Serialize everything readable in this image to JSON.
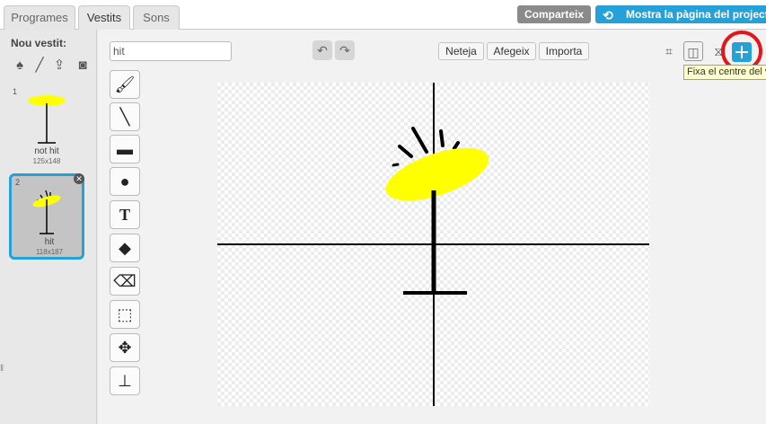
{
  "tabs": [
    {
      "label": "Programes"
    },
    {
      "label": "Vestits"
    },
    {
      "label": "Sons"
    }
  ],
  "header": {
    "share_label": "Comparteix",
    "project_page_label": "Mostra la pàgina del projecte"
  },
  "costume_panel": {
    "new_label": "Nou vestit:",
    "new_icons": [
      "sprite-library-icon",
      "paint-brush-icon",
      "upload-icon",
      "camera-icon"
    ],
    "costumes": [
      {
        "number": "1",
        "name": "not hit",
        "size": "125x148",
        "selected": false
      },
      {
        "number": "2",
        "name": "hit",
        "size": "118x187",
        "selected": true
      }
    ]
  },
  "editor": {
    "costume_name_value": "hit",
    "clear_label": "Neteja",
    "add_label": "Afegeix",
    "import_label": "Importa",
    "tooltip": "Fixa el centre del vestit",
    "tools": [
      "brush-icon",
      "line-icon",
      "rectangle-icon",
      "ellipse-icon",
      "text-icon",
      "fill-icon",
      "eraser-icon",
      "select-icon",
      "reshape-icon",
      "stamp-icon"
    ],
    "right_icons": [
      "crop-icon",
      "flip-horizontal-icon",
      "flip-vertical-icon",
      "set-center-icon"
    ]
  },
  "colors": {
    "accent": "#26a1d8",
    "highlight_circle": "#e3161b",
    "drawing_fill": "#ffff00"
  }
}
